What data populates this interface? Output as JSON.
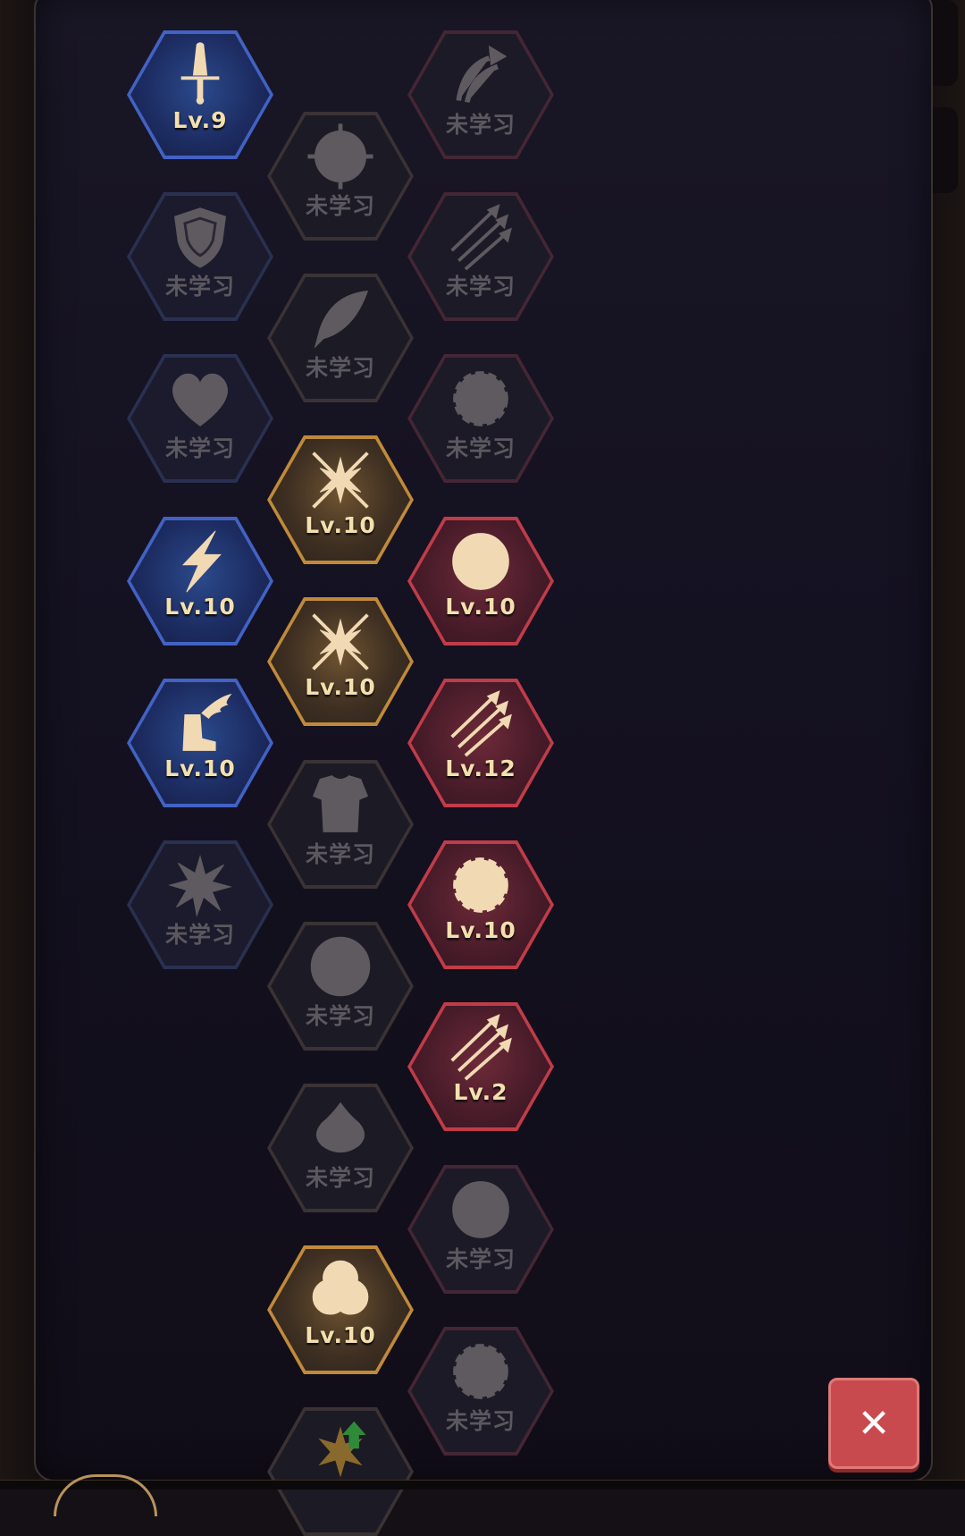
{
  "skill_tree": {
    "columns": [
      "blue",
      "gold",
      "red"
    ],
    "nodes": [
      {
        "column": "blue",
        "state": "learned",
        "label": "Lv.9",
        "icon": "dagger-icon"
      },
      {
        "column": "blue",
        "state": "locked",
        "label": "未学习",
        "icon": "shield-icon"
      },
      {
        "column": "blue",
        "state": "locked",
        "label": "未学习",
        "icon": "heart-icon"
      },
      {
        "column": "blue",
        "state": "learned",
        "label": "Lv.10",
        "icon": "lightning-icon"
      },
      {
        "column": "blue",
        "state": "learned",
        "label": "Lv.10",
        "icon": "winged-boots-icon"
      },
      {
        "column": "blue",
        "state": "locked",
        "label": "未学习",
        "icon": "explosion-icon"
      },
      {
        "column": "gold",
        "state": "locked",
        "label": "未学习",
        "icon": "crosshair-icon"
      },
      {
        "column": "gold",
        "state": "locked",
        "label": "未学习",
        "icon": "feather-icon"
      },
      {
        "column": "gold",
        "state": "learned",
        "label": "Lv.10",
        "icon": "crossed-swords-burst-icon"
      },
      {
        "column": "gold",
        "state": "learned",
        "label": "Lv.10",
        "icon": "crossed-swords-burst-icon"
      },
      {
        "column": "gold",
        "state": "locked",
        "label": "未学习",
        "icon": "armor-icon"
      },
      {
        "column": "gold",
        "state": "locked",
        "label": "未学习",
        "icon": "cross-emblem-icon"
      },
      {
        "column": "gold",
        "state": "locked",
        "label": "未学习",
        "icon": "slime-icon"
      },
      {
        "column": "gold",
        "state": "learned",
        "label": "Lv.10",
        "icon": "triquetra-rings-icon"
      },
      {
        "column": "gold",
        "state": "locked",
        "label": "",
        "icon": "crit-upgrade-icon"
      },
      {
        "column": "red",
        "state": "locked",
        "label": "未学习",
        "icon": "ricochet-icon"
      },
      {
        "column": "red",
        "state": "locked",
        "label": "未学习",
        "icon": "multi-arrow-icon"
      },
      {
        "column": "red",
        "state": "locked",
        "label": "未学习",
        "icon": "fist-burst-icon"
      },
      {
        "column": "red",
        "state": "learned",
        "label": "Lv.10",
        "icon": "concentric-target-icon"
      },
      {
        "column": "red",
        "state": "learned",
        "label": "Lv.12",
        "icon": "multi-arrow-icon"
      },
      {
        "column": "red",
        "state": "learned",
        "label": "Lv.10",
        "icon": "fist-burst-icon"
      },
      {
        "column": "red",
        "state": "learned",
        "label": "Lv.2",
        "icon": "multi-arrow-icon"
      },
      {
        "column": "red",
        "state": "locked",
        "label": "未学习",
        "icon": "concentric-target-icon"
      },
      {
        "column": "red",
        "state": "locked",
        "label": "未学习",
        "icon": "fist-burst-icon"
      }
    ]
  },
  "close_button": {
    "label": "✕",
    "icon": "close-icon"
  },
  "colors": {
    "blue": "#4262c4",
    "gold": "#c08a3a",
    "red": "#c03c48",
    "close": "#c94a4e"
  }
}
